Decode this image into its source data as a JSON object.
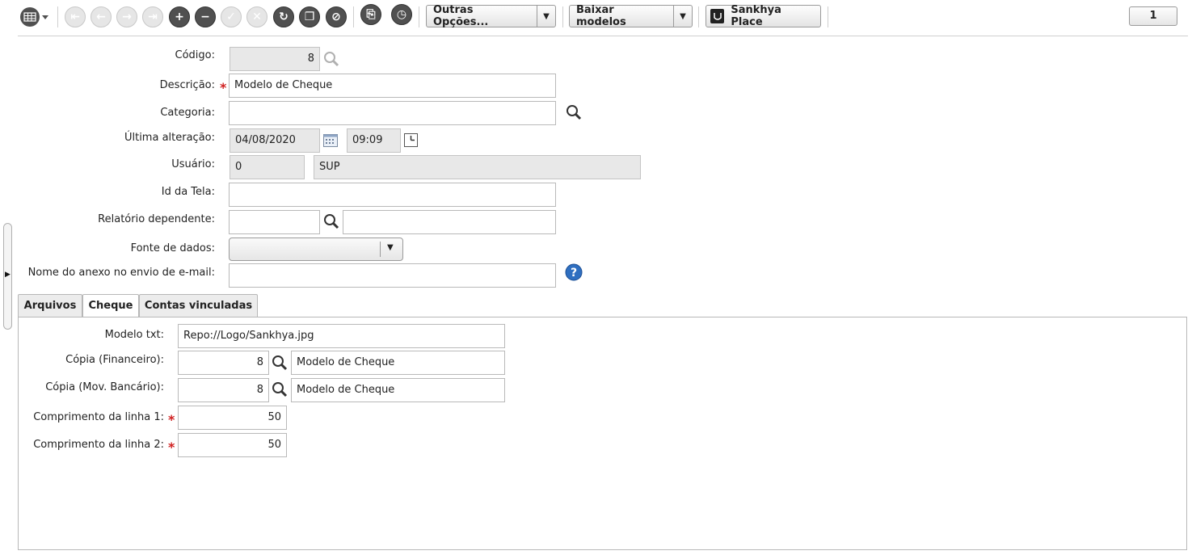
{
  "toolbar": {
    "outras_opcoes": "Outras Opções...",
    "baixar_modelos": "Baixar modelos",
    "sankhya_place": "Sankhya Place",
    "page_number": "1"
  },
  "form": {
    "codigo": {
      "label": "Código:",
      "value": "8"
    },
    "descricao": {
      "label": "Descrição:",
      "value": "Modelo de Cheque"
    },
    "categoria": {
      "label": "Categoria:",
      "value": ""
    },
    "ultima_alteracao": {
      "label": "Última alteração:",
      "date": "04/08/2020",
      "time": "09:09"
    },
    "usuario": {
      "label": "Usuário:",
      "code": "0",
      "name": "SUP"
    },
    "id_tela": {
      "label": "Id da Tela:",
      "value": ""
    },
    "relatorio_dependente": {
      "label": "Relatório dependente:",
      "code": "",
      "name": ""
    },
    "fonte_dados": {
      "label": "Fonte de dados:",
      "value": ""
    },
    "nome_anexo": {
      "label": "Nome do anexo no envio de e-mail:",
      "value": ""
    }
  },
  "tabs": [
    {
      "label": "Arquivos",
      "active": false
    },
    {
      "label": "Cheque",
      "active": true
    },
    {
      "label": "Contas vinculadas",
      "active": false
    }
  ],
  "cheque": {
    "modelo_txt": {
      "label": "Modelo txt:",
      "value": "Repo://Logo/Sankhya.jpg"
    },
    "copia_financeiro": {
      "label": "Cópia (Financeiro):",
      "code": "8",
      "name": "Modelo de Cheque"
    },
    "copia_mov_bancario": {
      "label": "Cópia (Mov. Bancário):",
      "code": "8",
      "name": "Modelo de Cheque"
    },
    "comprimento_linha1": {
      "label": "Comprimento da linha 1:",
      "value": "50"
    },
    "comprimento_linha2": {
      "label": "Comprimento da linha 2:",
      "value": "50"
    }
  },
  "required_marker": "*",
  "colors": {
    "required": "#d02020",
    "help": "#2f6fc0",
    "toolbar_active": "#505050"
  }
}
